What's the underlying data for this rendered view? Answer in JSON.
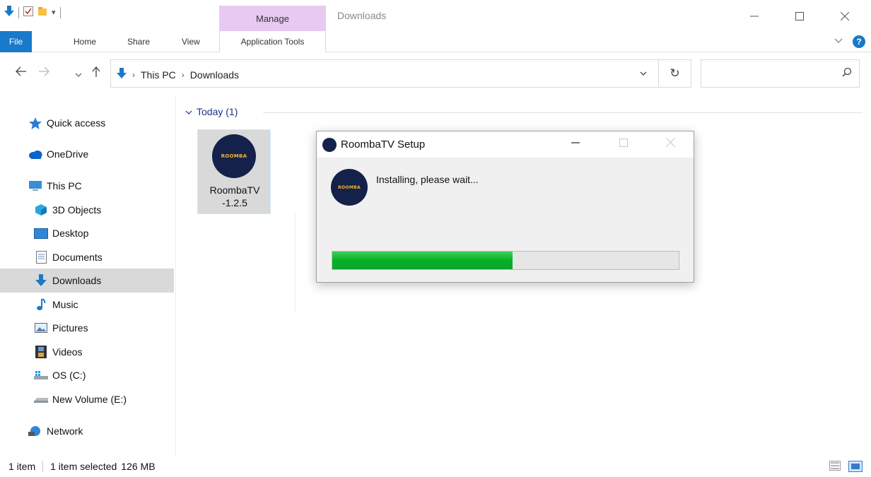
{
  "window": {
    "title": "Downloads",
    "manage_tab": "Manage",
    "controls": {
      "minimize": "—",
      "maximize": "☐",
      "close": "✕"
    }
  },
  "ribbon": {
    "file": "File",
    "home": "Home",
    "share": "Share",
    "view": "View",
    "app_tools": "Application Tools",
    "help": "?"
  },
  "address": {
    "crumb_root": "This PC",
    "crumb_current": "Downloads",
    "search_placeholder": ""
  },
  "nav": {
    "items": [
      {
        "label": "Quick access",
        "icon": "star-icon"
      },
      {
        "label": "OneDrive",
        "icon": "cloud-icon"
      },
      {
        "label": "This PC",
        "icon": "computer-icon"
      },
      {
        "label": "3D Objects",
        "icon": "cube-icon"
      },
      {
        "label": "Desktop",
        "icon": "desktop-icon"
      },
      {
        "label": "Documents",
        "icon": "document-icon"
      },
      {
        "label": "Downloads",
        "icon": "download-arrow-icon"
      },
      {
        "label": "Music",
        "icon": "music-note-icon"
      },
      {
        "label": "Pictures",
        "icon": "pictures-icon"
      },
      {
        "label": "Videos",
        "icon": "film-icon"
      },
      {
        "label": "OS (C:)",
        "icon": "os-drive-icon"
      },
      {
        "label": "New Volume (E:)",
        "icon": "drive-icon"
      },
      {
        "label": "Network",
        "icon": "network-icon"
      }
    ],
    "selected": "Downloads"
  },
  "content": {
    "group_label": "Today (1)",
    "file": {
      "name_line1": "RoombaTV",
      "name_line2": "-1.2.5",
      "logo_text": "ROOMBA"
    }
  },
  "dialog": {
    "title": "RoombaTV Setup",
    "message": "Installing, please wait...",
    "progress_fraction": 0.52,
    "progress_color": "#06b025",
    "logo_text": "ROOMBA"
  },
  "status": {
    "count": "1 item",
    "selection": "1 item selected",
    "size": "126 MB"
  },
  "colors": {
    "accent": "#1979ca",
    "manage_tab": "#e8c9f2",
    "group_header": "#1e3287"
  }
}
